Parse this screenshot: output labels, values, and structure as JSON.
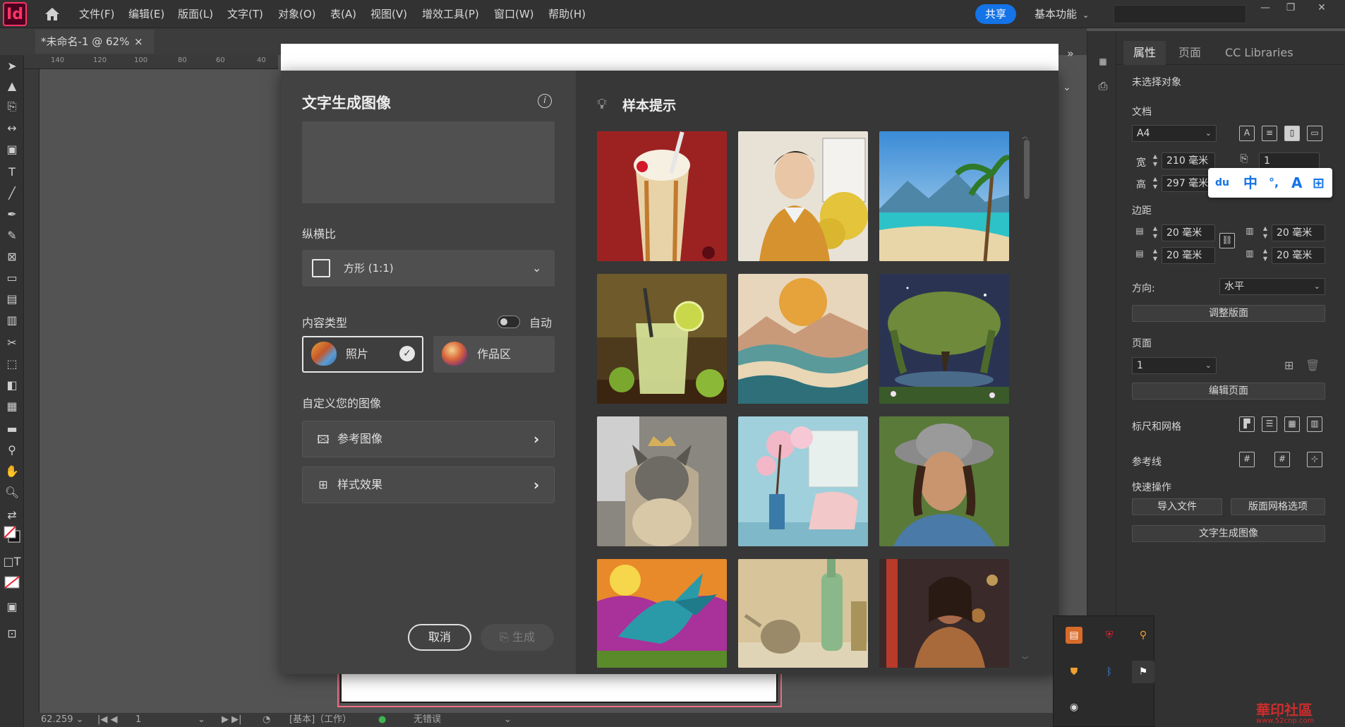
{
  "app": {
    "logo": "Id",
    "menu": [
      "文件(F)",
      "编辑(E)",
      "版面(L)",
      "文字(T)",
      "对象(O)",
      "表(A)",
      "视图(V)",
      "增效工具(P)",
      "窗口(W)",
      "帮助(H)"
    ],
    "share": "共享",
    "workspace": "基本功能"
  },
  "document": {
    "tab_title": "*未命名-1 @ 62%",
    "tab_close": "×",
    "ruler_ticks": [
      "140",
      "120",
      "100",
      "80",
      "60",
      "40"
    ]
  },
  "status": {
    "zoom": "62.259",
    "page": "1",
    "mode": "[基本]（工作）",
    "errors": "无错误"
  },
  "dialog": {
    "title": "文字生成图像",
    "prompt_placeholder": "",
    "aspect_label": "纵横比",
    "aspect_value": "方形 (1:1)",
    "content_type_label": "内容类型",
    "auto_label": "自动",
    "content_types": [
      {
        "label": "照片",
        "selected": true
      },
      {
        "label": "作品区",
        "selected": false
      }
    ],
    "customize_label": "自定义您的图像",
    "custom_options": [
      {
        "label": "参考图像"
      },
      {
        "label": "样式效果"
      }
    ],
    "cancel": "取消",
    "generate": "生成",
    "samples_title": "样本提示"
  },
  "panel": {
    "tabs": [
      "属性",
      "页面",
      "CC Libraries"
    ],
    "no_selection": "未选择对象",
    "doc_label": "文档",
    "page_size": "A4",
    "width_label": "宽",
    "width_value": "210 毫米",
    "height_label": "高",
    "height_value": "297 毫米",
    "pages_value": "1",
    "margins_label": "边距",
    "margin_top": "20 毫米",
    "margin_bottom": "20 毫米",
    "margin_left": "20 毫米",
    "margin_right": "20 毫米",
    "orientation_label": "方向:",
    "orientation_value": "水平",
    "adjust_layout": "调整版面",
    "pages_label": "页面",
    "page_value": "1",
    "edit_page": "编辑页面",
    "rulers_grids": "标尺和网格",
    "guides": "参考线",
    "quick_actions": "快速操作",
    "import_file": "导入文件",
    "layout_grid": "版面网格选项",
    "text_to_image": "文字生成图像"
  },
  "ime": {
    "items": [
      "du",
      "中",
      "°,",
      "A",
      "⊞"
    ]
  },
  "watermark": {
    "text": "華印社區",
    "sub": "www.52cnp.com"
  },
  "colors": {
    "accent": "#1473e6",
    "brand": "#ff3366",
    "dialog_bg": "#474747"
  }
}
